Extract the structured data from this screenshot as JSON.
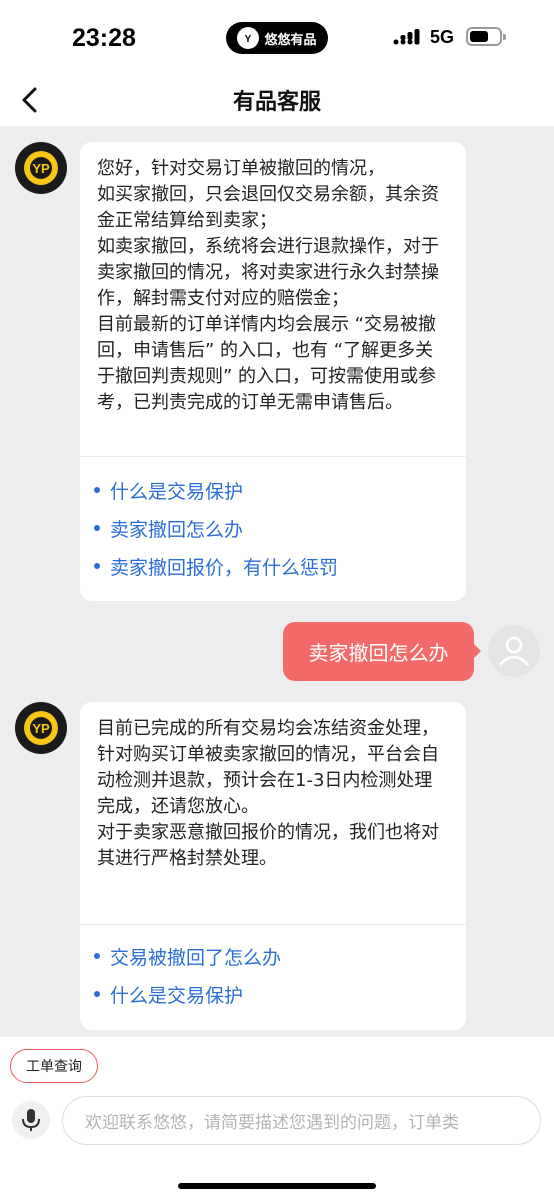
{
  "status_bar": {
    "time": "23:28",
    "island_label": "悠悠有品",
    "network": "5G",
    "battery_level": 0.65
  },
  "nav": {
    "title": "有品客服",
    "back_icon": "chevron-left-icon"
  },
  "messages": [
    {
      "from": "bot",
      "text": "您好，针对交易订单被撤回的情况，\n如买家撤回，只会退回仅交易余额，其余资金正常结算给到卖家；\n如卖家撤回，系统将会进行退款操作，对于卖家撤回的情况，将对卖家进行永久封禁操作，解封需支付对应的赔偿金；\n目前最新的订单详情内均会展示 “交易被撤回，申请售后” 的入口，也有 “了解更多关于撤回判责规则” 的入口，可按需使用或参考，已判责完成的订单无需申请售后。",
      "links": [
        "什么是交易保护",
        "卖家撤回怎么办",
        "卖家撤回报价，有什么惩罚"
      ]
    },
    {
      "from": "user",
      "text": "卖家撤回怎么办"
    },
    {
      "from": "bot",
      "text": "目前已完成的所有交易均会冻结资金处理，针对购买订单被卖家撤回的情况，平台会自动检测并退款，预计会在1-3日内检测处理完成，还请您放心。\n对于卖家恶意撤回报价的情况，我们也将对其进行严格封禁处理。",
      "links": [
        "交易被撤回了怎么办",
        "什么是交易保护"
      ]
    }
  ],
  "bottom": {
    "ticket_button": "工单查询",
    "input_placeholder": "欢迎联系悠悠，请简要描述您遇到的问题，订单类",
    "mic_icon": "microphone-icon"
  },
  "colors": {
    "accent_red": "#f26a6a",
    "link_blue": "#2d6ed6",
    "background": "#ededf0",
    "logo_yellow": "#f5c518"
  }
}
